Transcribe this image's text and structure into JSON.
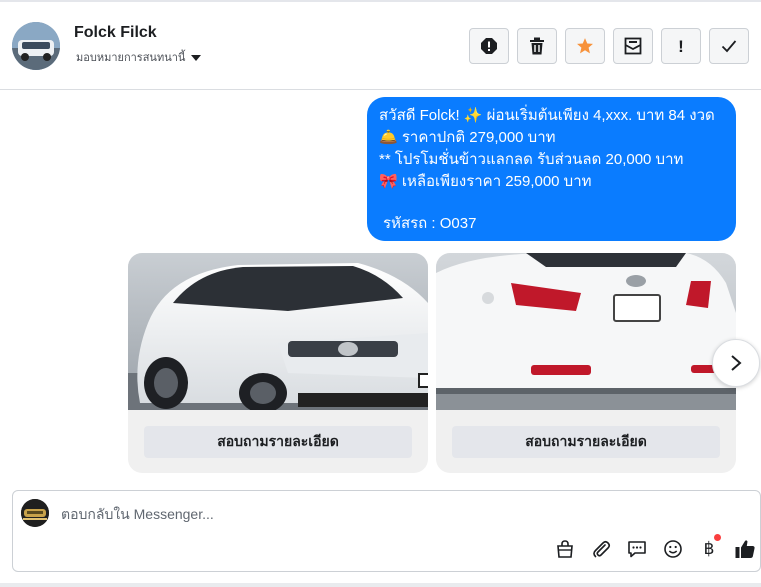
{
  "contact": {
    "name": "Folck Filck",
    "assign_label": "มอบหมายการสนทนานี้"
  },
  "header_actions": [
    {
      "icon": "spam-alert-icon"
    },
    {
      "icon": "trash-icon"
    },
    {
      "icon": "star-icon"
    },
    {
      "icon": "mark-unread-icon"
    },
    {
      "icon": "follow-up-icon",
      "text": "!"
    },
    {
      "icon": "check-icon"
    }
  ],
  "message": {
    "lines": [
      "สวัสดี Folck! ✨  ผ่อนเริ่มต้นเพียง 4,xxx. บาท 84 งวด",
      "🛎️ ราคาปกติ 279,000 บาท",
      "** โปรโมชั่นข้าวแลกลด รับส่วนลด 20,000 บาท",
      "🎀  เหลือเพียงราคา 259,000 บาท"
    ],
    "code": "รหัสรถ : O037"
  },
  "cards": [
    {
      "button_label": "สอบถามรายละเอียด"
    },
    {
      "button_label": "สอบถามรายละเอียด"
    }
  ],
  "composer": {
    "placeholder": "ตอบกลับใน Messenger..."
  },
  "colors": {
    "bubble": "#0a7cff",
    "star": "#f7923b",
    "notification_dot": "#fa3e3e"
  }
}
